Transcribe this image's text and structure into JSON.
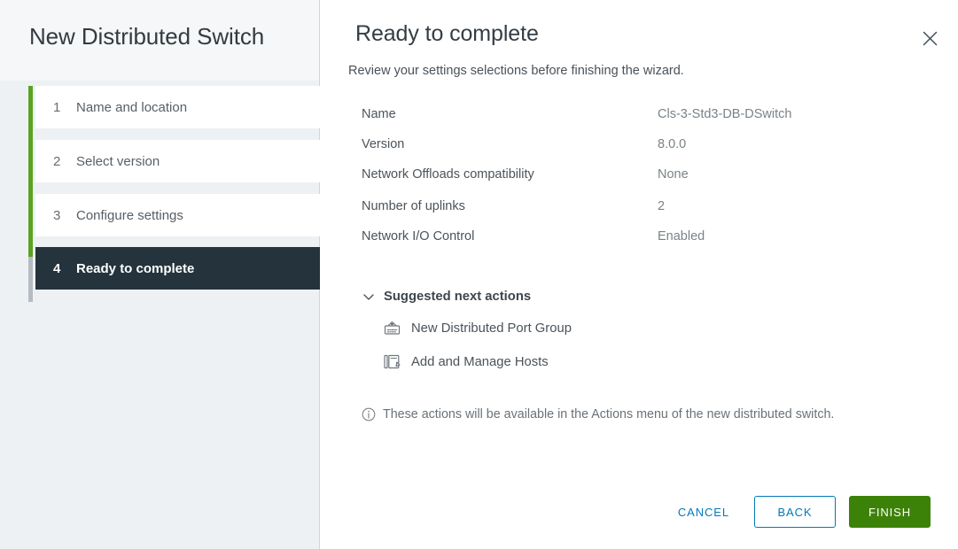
{
  "sidebar": {
    "title": "New Distributed Switch",
    "steps": [
      {
        "num": "1",
        "label": "Name and location",
        "state": "complete"
      },
      {
        "num": "2",
        "label": "Select version",
        "state": "complete"
      },
      {
        "num": "3",
        "label": "Configure settings",
        "state": "complete"
      },
      {
        "num": "4",
        "label": "Ready to complete",
        "state": "active"
      }
    ]
  },
  "main": {
    "title": "Ready to complete",
    "subtitle": "Review your settings selections before finishing the wizard.",
    "close_icon": "close-icon",
    "summary": [
      {
        "label": "Name",
        "value": "Cls-3-Std3-DB-DSwitch"
      },
      {
        "label": "Version",
        "value": "8.0.0"
      },
      {
        "label": "Network Offloads compatibility",
        "value": "None"
      },
      {
        "label": "Number of uplinks",
        "value": "2"
      },
      {
        "label": "Network I/O Control",
        "value": "Enabled"
      }
    ],
    "suggested_actions": {
      "title": "Suggested next actions",
      "expanded": true,
      "chevron_icon": "chevron-down-icon",
      "items": [
        {
          "label": "New Distributed Port Group",
          "icon": "port-group-icon"
        },
        {
          "label": "Add and Manage Hosts",
          "icon": "add-manage-hosts-icon"
        }
      ]
    },
    "note": {
      "icon": "info-circle-icon",
      "text": "These actions will be available in the Actions menu of the new distributed switch."
    }
  },
  "footer": {
    "cancel_label": "CANCEL",
    "back_label": "BACK",
    "finish_label": "FINISH"
  },
  "colors": {
    "progress_complete": "#5aa220",
    "progress_remaining": "#b5bbc1",
    "active_step_bg": "#24333c",
    "link_blue": "#0079b8",
    "primary_green": "#3d8208",
    "sidebar_bg": "#eef1f4"
  }
}
